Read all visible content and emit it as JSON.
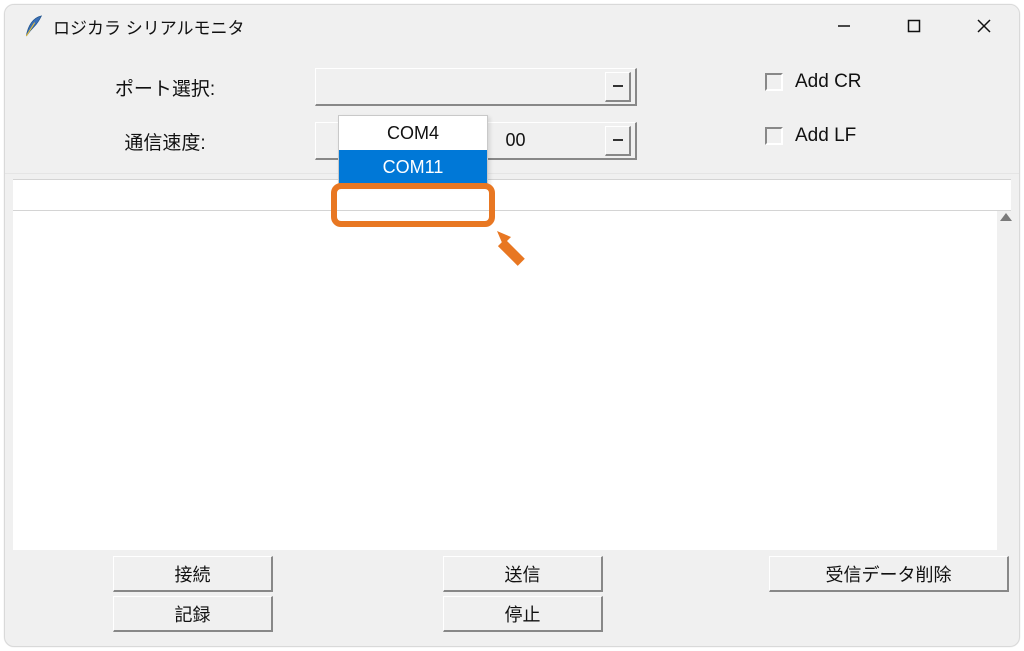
{
  "window": {
    "title": "ロジカラ シリアルモニタ"
  },
  "config": {
    "port_label": "ポート選択:",
    "baud_label": "通信速度:",
    "port_value": "",
    "baud_value": "00",
    "cr_label": "Add CR",
    "lf_label": "Add LF"
  },
  "dropdown": {
    "options": [
      "COM4",
      "COM11"
    ],
    "selected": "COM11"
  },
  "buttons": {
    "connect": "接続",
    "record": "記録",
    "send": "送信",
    "stop": "停止",
    "clear_rx": "受信データ削除"
  },
  "colors": {
    "highlight_blue": "#0078d7",
    "annotation_orange": "#e87722"
  }
}
